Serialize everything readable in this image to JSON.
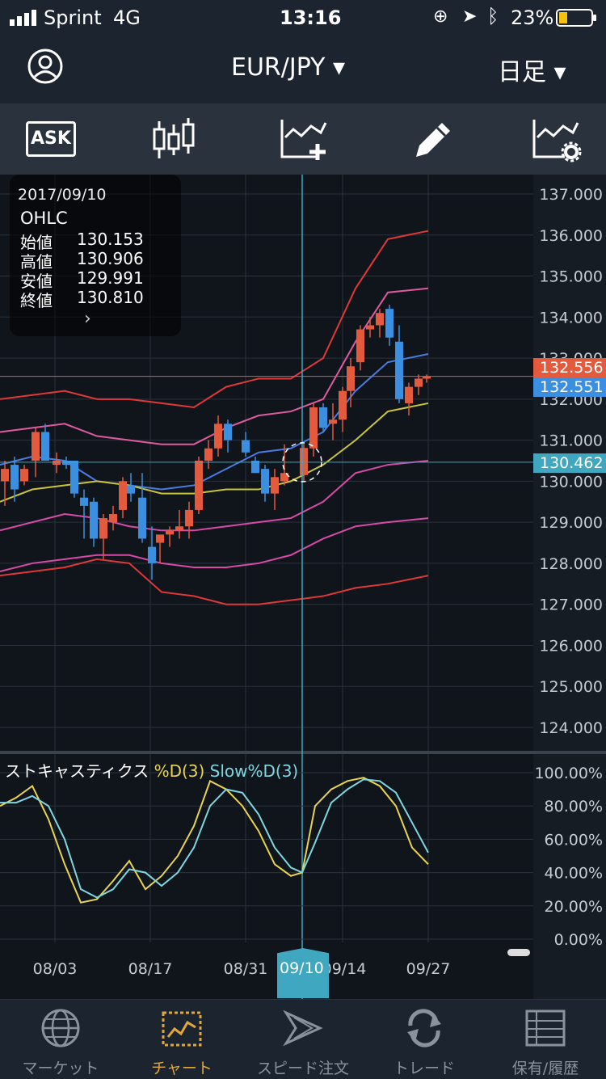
{
  "status": {
    "carrier": "Sprint",
    "network": "4G",
    "time": "13:16",
    "battery": "23%"
  },
  "nav": {
    "pair": "EUR/JPY ▾",
    "period": "日足 ▾"
  },
  "toolbar": {
    "ask_label": "ASK"
  },
  "ohlc": {
    "date": "2017/09/10",
    "title": "OHLC",
    "rows": [
      {
        "label": "始値",
        "value": "130.153"
      },
      {
        "label": "高値",
        "value": "130.906"
      },
      {
        "label": "安値",
        "value": "129.991"
      },
      {
        "label": "終値",
        "value": "130.810"
      }
    ]
  },
  "price_axis": [
    "137.000",
    "136.000",
    "135.000",
    "134.000",
    "133.000",
    "132.000",
    "131.000",
    "130.000",
    "129.000",
    "128.000",
    "127.000",
    "126.000",
    "125.000",
    "124.000"
  ],
  "price_tags": {
    "ask": "132.556",
    "bid": "132.551",
    "cursor": "130.462"
  },
  "indicator": {
    "name": "ストキャスティクス",
    "d_label": "%D(3)",
    "slow_label": "Slow%D(3)"
  },
  "osc_axis": [
    "100.00%",
    "80.00%",
    "60.00%",
    "40.00%",
    "20.00%",
    "0.00%"
  ],
  "dates": {
    "d1": "08/03",
    "d2": "08/17",
    "d3": "08/31",
    "d4": "09/14",
    "d5": "09/27",
    "selected": "09/10"
  },
  "tabs": [
    {
      "label": "マーケット",
      "icon": "globe-icon"
    },
    {
      "label": "チャート",
      "icon": "chart-icon"
    },
    {
      "label": "スピード注文",
      "icon": "speed-icon"
    },
    {
      "label": "トレード",
      "icon": "trade-icon"
    },
    {
      "label": "保有/履歴",
      "icon": "history-icon"
    }
  ],
  "colors": {
    "bull": "#e35a3c",
    "bear": "#3b8fe0",
    "cursor_tag": "#3fa7c0",
    "d_line": "#e8d451",
    "slow_line": "#7fd6e0",
    "active_tab": "#e0a73a"
  },
  "chart_data": {
    "type": "candlestick",
    "pair": "EUR/JPY",
    "ylim": [
      124,
      137
    ],
    "selected_candle": {
      "date": "2017/09/10",
      "open": 130.153,
      "high": 130.906,
      "low": 129.991,
      "close": 130.81
    },
    "stochastic_ylim": [
      0,
      100
    ]
  }
}
